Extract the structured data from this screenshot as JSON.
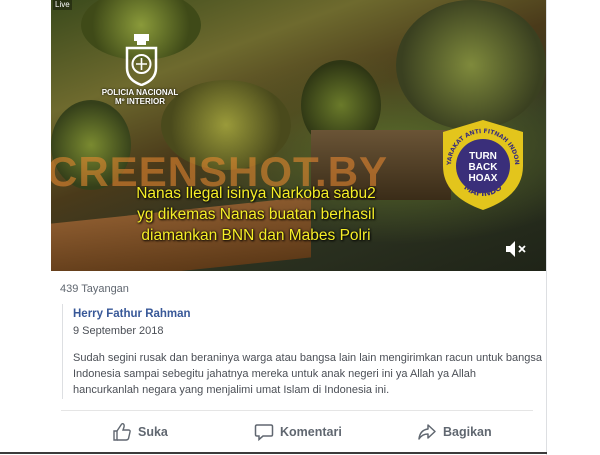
{
  "video": {
    "live_tag": "Live",
    "police_label_line1": "POLICIA NACIONAL",
    "police_label_line2": "Mº INTERIOR",
    "caption_line1": "Nanas Ilegal isinya Narkoba sabu2",
    "caption_line2": "yg dikemas Nanas buatan berhasil",
    "caption_line3": "diamankan BNN dan  Mabes Polri",
    "watermark": "SCREENSHOT.BY",
    "badge": {
      "ring_text": "MASYARAKAT ANTI FITNAH INDONESIA",
      "bottom_text": "MAFINDO",
      "line1": "TURN",
      "line2": "BACK",
      "line3": "HOAX"
    },
    "mute_icon": "volume-muted-icon",
    "colors": {
      "caption": "#f6ee28",
      "badge_fill": "#3a2f7a",
      "badge_ring": "#e3c51c"
    }
  },
  "post": {
    "views": "439 Tayangan",
    "author": "Herry Fathur Rahman",
    "date": "9 September 2018",
    "body": "Sudah segini rusak dan beraninya warga atau bangsa lain lain mengirimkan racun untuk bangsa Indonesia sampai sebegitu jahatnya mereka untuk anak negeri ini ya Allah ya Allah hancurkanlah negara yang menjalimi umat Islam di Indonesia ini."
  },
  "actions": {
    "like_label": "Suka",
    "comment_label": "Komentari",
    "share_label": "Bagikan",
    "like_icon": "thumbs-up-icon",
    "comment_icon": "comment-icon",
    "share_icon": "share-icon"
  }
}
